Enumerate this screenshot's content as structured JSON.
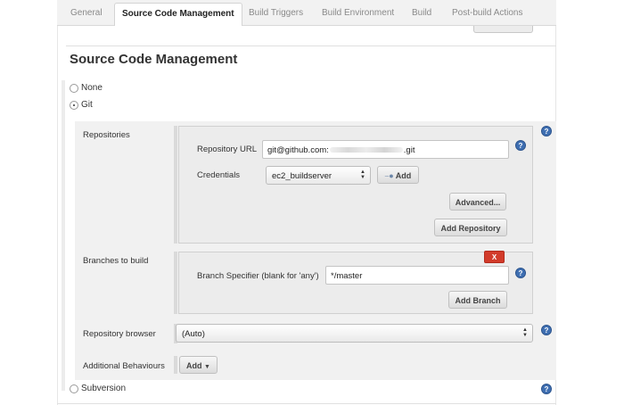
{
  "tabs": [
    {
      "label": "General",
      "active": false
    },
    {
      "label": "Source Code Management",
      "active": true
    },
    {
      "label": "Build Triggers",
      "active": false
    },
    {
      "label": "Build Environment",
      "active": false
    },
    {
      "label": "Build",
      "active": false
    },
    {
      "label": "Post-build Actions",
      "active": false
    }
  ],
  "section_title": "Source Code Management",
  "scm_options": {
    "none": {
      "label": "None",
      "selected": false
    },
    "git": {
      "label": "Git",
      "selected": true
    },
    "subversion": {
      "label": "Subversion",
      "selected": false
    }
  },
  "repositories": {
    "label": "Repositories",
    "url_label": "Repository URL",
    "url_prefix": "git@github.com:",
    "url_suffix": ".git",
    "credentials_label": "Credentials",
    "credentials_value": "ec2_buildserver",
    "add_credentials_label": "Add",
    "advanced_label": "Advanced...",
    "add_repository_label": "Add Repository"
  },
  "branches": {
    "label": "Branches to build",
    "delete_label": "X",
    "specifier_label": "Branch Specifier (blank for 'any')",
    "specifier_value": "*/master",
    "add_branch_label": "Add Branch"
  },
  "repository_browser": {
    "label": "Repository browser",
    "value": "(Auto)"
  },
  "additional_behaviours": {
    "label": "Additional Behaviours",
    "add_label": "Add"
  },
  "help_glyph": "?",
  "colors": {
    "accent_help": "#3f6fb2",
    "delete_red": "#d23b2a",
    "panel_bg": "#f1f1f1"
  }
}
